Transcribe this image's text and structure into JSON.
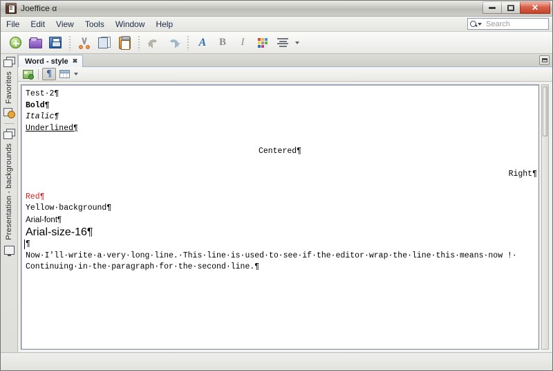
{
  "window": {
    "title": "Joeffice α",
    "app_icon": "document-app-icon",
    "controls": {
      "minimize": "minimize-button",
      "maximize": "maximize-button",
      "close_label": "✕"
    }
  },
  "menubar": {
    "items": [
      {
        "label": "File"
      },
      {
        "label": "Edit"
      },
      {
        "label": "View"
      },
      {
        "label": "Tools"
      },
      {
        "label": "Window"
      },
      {
        "label": "Help"
      }
    ]
  },
  "search": {
    "placeholder": "Search",
    "value": "",
    "icon": "search-magnifier-dropdown-icon"
  },
  "toolbar": {
    "buttons": [
      {
        "name": "new-document-button",
        "icon": "new-document-icon",
        "label": ""
      },
      {
        "name": "open-file-button",
        "icon": "open-folder-icon",
        "label": ""
      },
      {
        "name": "save-button",
        "icon": "save-floppy-icon",
        "label": ""
      },
      {
        "name": "cut-button",
        "icon": "scissors-icon",
        "label": ""
      },
      {
        "name": "copy-button",
        "icon": "copy-pages-icon",
        "label": ""
      },
      {
        "name": "paste-button",
        "icon": "clipboard-paste-icon",
        "label": ""
      },
      {
        "name": "undo-button",
        "icon": "undo-arrow-icon",
        "label": ""
      },
      {
        "name": "redo-button",
        "icon": "redo-arrow-icon",
        "label": ""
      },
      {
        "name": "font-button",
        "icon": "font-letter-a-icon",
        "label": "A"
      },
      {
        "name": "bold-button",
        "icon": "bold-b-icon",
        "label": "B"
      },
      {
        "name": "italic-button",
        "icon": "italic-i-icon",
        "label": "I"
      },
      {
        "name": "color-palette-button",
        "icon": "color-grid-icon",
        "label": ""
      },
      {
        "name": "paragraph-align-button",
        "icon": "align-lines-icon",
        "label": ""
      }
    ],
    "palette_colors": [
      "#e8422a",
      "#f0b03c",
      "#4c8fd8",
      "#f0d24a",
      "#9a9a9a",
      "#6fb02c",
      "#2f6fb5",
      "#c33b8c",
      "#e8e8e6"
    ]
  },
  "rail": {
    "top_icon": "window-group-icon",
    "favorites_label": "Favorites",
    "settings_icon": "settings-gear-window-icon",
    "second_icon": "window-group-icon",
    "presentation_label": "Presentation - backgrounds",
    "bottom_icon": "monitor-window-icon"
  },
  "editor": {
    "tab": {
      "label": "Word - style",
      "close_glyph": "✖"
    },
    "tab_minimize": "tab-group-minimize-button",
    "subtoolbar": [
      {
        "name": "insert-image-button",
        "icon": "insert-image-icon",
        "active": false
      },
      {
        "name": "show-formatting-marks-button",
        "icon": "pilcrow-icon",
        "active": true,
        "label": "¶"
      },
      {
        "name": "insert-table-button",
        "icon": "table-icon",
        "active": false
      },
      {
        "name": "more-options-button",
        "icon": "chevron-down-icon",
        "active": false
      }
    ]
  },
  "document": {
    "lines": [
      {
        "text": "Test·2¶",
        "style": "plain",
        "name": "doc-line-test"
      },
      {
        "text": "Bold¶",
        "style": "bold",
        "name": "doc-line-bold"
      },
      {
        "text": "Italic¶",
        "style": "italic",
        "name": "doc-line-italic"
      },
      {
        "text": "Underlined¶",
        "style": "underline",
        "name": "doc-line-underlined"
      },
      {
        "text": "",
        "style": "blank",
        "name": "doc-line-blank-1"
      },
      {
        "text": "Centered¶",
        "style": "center",
        "name": "doc-line-centered"
      },
      {
        "text": "",
        "style": "blank",
        "name": "doc-line-blank-2"
      },
      {
        "text": "Right¶",
        "style": "right",
        "name": "doc-line-right"
      },
      {
        "text": "",
        "style": "blank",
        "name": "doc-line-blank-3"
      },
      {
        "text": "Red¶",
        "style": "red",
        "name": "doc-line-red"
      },
      {
        "text": "Yellow·background¶",
        "style": "plain",
        "name": "doc-line-yellow-background"
      },
      {
        "text": "Arial-font¶",
        "style": "sans",
        "name": "doc-line-arial-font"
      },
      {
        "text": "Arial-size-16¶",
        "style": "sans16",
        "name": "doc-line-arial-size-16"
      },
      {
        "text": "¶",
        "style": "caret",
        "name": "doc-line-caret"
      },
      {
        "text": "Now·I'll·write·a·very·long·line.·This·line·is·used·to·see·if·the·editor·wrap·the·line·this·means·now !·",
        "style": "plain",
        "name": "doc-line-long-1"
      },
      {
        "text": "Continuing·in·the·paragraph·for·the·second·line.¶",
        "style": "plain",
        "name": "doc-line-long-2"
      }
    ]
  },
  "statusbar": {
    "text": ""
  },
  "colors": {
    "accent": "#3a5f9e",
    "red_text": "#e02020",
    "close_button": "#c4432b",
    "frame": "#6f6f6f"
  }
}
